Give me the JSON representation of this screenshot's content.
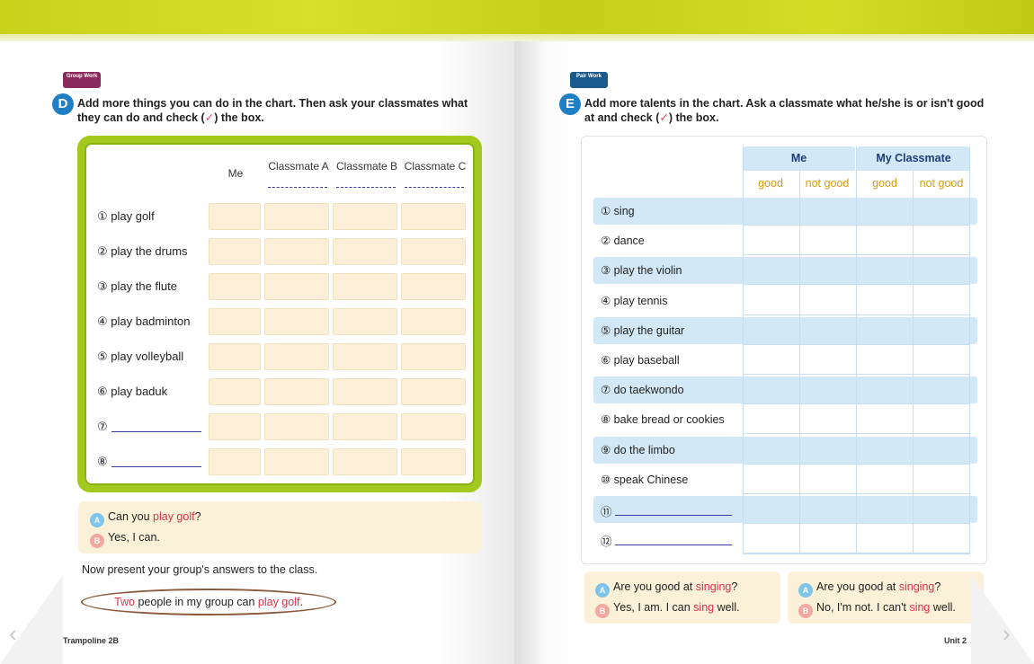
{
  "left": {
    "badge": "Group Work",
    "letter": "D",
    "instruction_1": "Add more things you can do in the chart. Then ask your classmates what",
    "instruction_2a": "they can do and check (",
    "instruction_check": "✓",
    "instruction_2b": ") the box.",
    "headers": [
      "Me",
      "Classmate A",
      "Classmate B",
      "Classmate C"
    ],
    "rows": [
      "① play golf",
      "② play the drums",
      "③ play the flute",
      "④ play badminton",
      "⑤ play volleyball",
      "⑥ play baduk",
      "⑦",
      "⑧"
    ],
    "dialog": {
      "a_label": "A",
      "a_pre": "Can you ",
      "a_red": "play golf",
      "a_post": "?",
      "b_label": "B",
      "b_text": "Yes, I can."
    },
    "present": "Now present your group's answers to the class.",
    "bubble": {
      "red1": "Two",
      "mid": " people in my group can ",
      "red2": "play golf",
      "post": "."
    },
    "footer": "Trampoline 2B"
  },
  "right": {
    "badge": "Pair Work",
    "letter": "E",
    "instruction_1": "Add more talents in the chart. Ask a classmate what he/she is or isn't good",
    "instruction_2a": "at and check (",
    "instruction_check": "✓",
    "instruction_2b": ") the box.",
    "groups": [
      "Me",
      "My Classmate"
    ],
    "subheaders": [
      "good",
      "not good",
      "good",
      "not good"
    ],
    "rows": [
      "① sing",
      "② dance",
      "③ play the violin",
      "④ play tennis",
      "⑤ play the guitar",
      "⑥ play baseball",
      "⑦ do taekwondo",
      "⑧ bake bread or cookies",
      "⑨ do the limbo",
      "⑩ speak Chinese",
      "⑪",
      "⑫"
    ],
    "dialog1": {
      "a_label": "A",
      "a_pre": "Are you good at ",
      "a_red": "singing",
      "a_post": "?",
      "b_label": "B",
      "b_pre": "Yes, I am. I can ",
      "b_red": "sing",
      "b_post": " well."
    },
    "dialog2": {
      "a_label": "A",
      "a_pre": "Are you good at ",
      "a_red": "singing",
      "a_post": "?",
      "b_label": "B",
      "b_pre": "No, I'm not. I can't ",
      "b_red": "sing",
      "b_post": " well."
    },
    "footer": "Unit 2"
  }
}
